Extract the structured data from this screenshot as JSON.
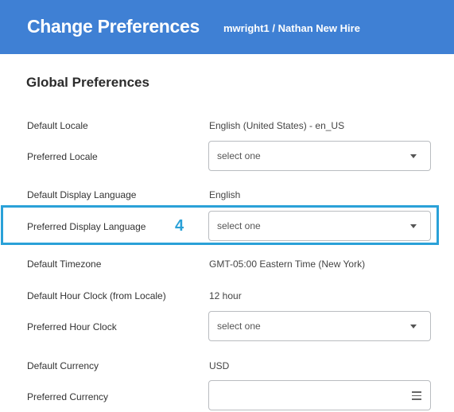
{
  "header": {
    "title": "Change Preferences",
    "user": "mwright1 / Nathan New Hire"
  },
  "section": {
    "title": "Global Preferences"
  },
  "rows": {
    "default_locale": {
      "label": "Default Locale",
      "value": "English (United States) - en_US"
    },
    "preferred_locale": {
      "label": "Preferred Locale",
      "value": "select one"
    },
    "default_display_language": {
      "label": "Default Display Language",
      "value": "English"
    },
    "preferred_display_language": {
      "label": "Preferred Display Language",
      "value": "select one"
    },
    "default_timezone": {
      "label": "Default Timezone",
      "value": "GMT-05:00 Eastern Time (New York)"
    },
    "default_hour_clock": {
      "label": "Default Hour Clock (from Locale)",
      "value": "12 hour"
    },
    "preferred_hour_clock": {
      "label": "Preferred Hour Clock",
      "value": "select one"
    },
    "default_currency": {
      "label": "Default Currency",
      "value": "USD"
    },
    "preferred_currency": {
      "label": "Preferred Currency",
      "value": ""
    }
  },
  "annotation": {
    "step": "4",
    "color": "#2aa1d8"
  },
  "icons": {
    "dropdown": "chevron-down-icon",
    "list": "list-icon"
  },
  "colors": {
    "header_bg": "#3f80d4",
    "header_text": "#ffffff"
  }
}
